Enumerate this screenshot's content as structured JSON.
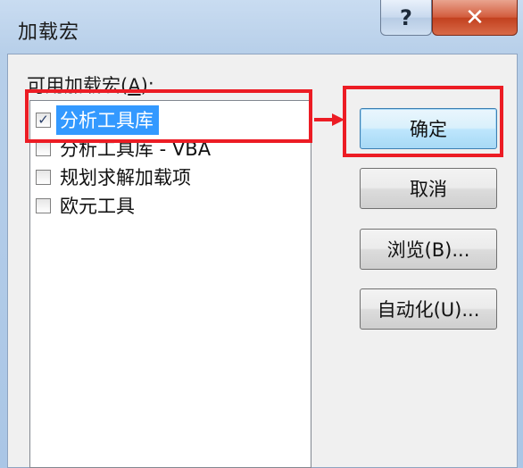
{
  "window": {
    "title": "加载宏",
    "help_glyph": "?",
    "close_glyph": "✕"
  },
  "addins": {
    "label_prefix": "可用加载宏(",
    "label_accel": "A",
    "label_suffix": "):",
    "items": [
      {
        "label": "分析工具库",
        "checked": true,
        "selected": true
      },
      {
        "label": "分析工具库 - VBA",
        "checked": false,
        "selected": false
      },
      {
        "label": "规划求解加载项",
        "checked": false,
        "selected": false
      },
      {
        "label": "欧元工具",
        "checked": false,
        "selected": false
      }
    ]
  },
  "buttons": {
    "ok": "确定",
    "cancel": "取消",
    "browse": "浏览(B)...",
    "automation": "自动化(U)..."
  },
  "icons": {
    "check": "✓"
  },
  "colors": {
    "highlight": "#ec1c24",
    "selection": "#3399ff"
  }
}
